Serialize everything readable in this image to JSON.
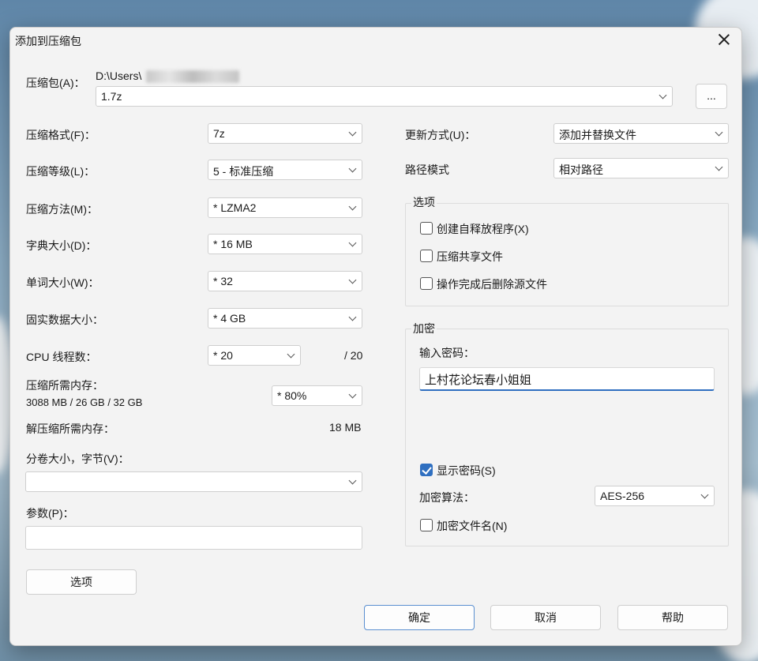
{
  "window": {
    "title": "添加到压缩包"
  },
  "archive": {
    "label": "压缩包(A)：",
    "path_prefix": "D:\\Users\\",
    "filename": "1.7z",
    "browse_label": "..."
  },
  "left": {
    "format": {
      "label": "压缩格式(F)：",
      "value": "7z"
    },
    "level": {
      "label": "压缩等级(L)：",
      "value": "5 - 标准压缩"
    },
    "method": {
      "label": "压缩方法(M)：",
      "value": "* LZMA2"
    },
    "dict": {
      "label": "字典大小(D)：",
      "value": "* 16 MB"
    },
    "word": {
      "label": "单词大小(W)：",
      "value": "* 32"
    },
    "solid": {
      "label": "固实数据大小：",
      "value": "* 4 GB"
    },
    "threads": {
      "label": "CPU 线程数：",
      "value": "* 20",
      "max": "/ 20"
    },
    "mem_compress": {
      "label": "压缩所需内存：",
      "detail": "3088 MB / 26 GB / 32 GB",
      "value": "* 80%"
    },
    "mem_decompress": {
      "label": "解压缩所需内存：",
      "value": "18 MB"
    },
    "volume": {
      "label": "分卷大小，字节(V)：",
      "value": ""
    },
    "params": {
      "label": "参数(P)：",
      "value": ""
    },
    "options_button": "选项"
  },
  "right": {
    "update": {
      "label": "更新方式(U)：",
      "value": "添加并替换文件"
    },
    "pathmode": {
      "label": "路径模式",
      "value": "相对路径"
    },
    "options": {
      "title": "选项",
      "sfx": {
        "label": "创建自释放程序(X)",
        "checked": false
      },
      "shared": {
        "label": "压缩共享文件",
        "checked": false
      },
      "delete": {
        "label": "操作完成后删除源文件",
        "checked": false
      }
    },
    "encryption": {
      "title": "加密",
      "password_label": "输入密码：",
      "password_value": "上村花论坛春小姐姐",
      "show_password": {
        "label": "显示密码(S)",
        "checked": true
      },
      "method_label": "加密算法：",
      "method_value": "AES-256",
      "encrypt_names": {
        "label": "加密文件名(N)",
        "checked": false
      }
    }
  },
  "buttons": {
    "ok": "确定",
    "cancel": "取消",
    "help": "帮助"
  }
}
